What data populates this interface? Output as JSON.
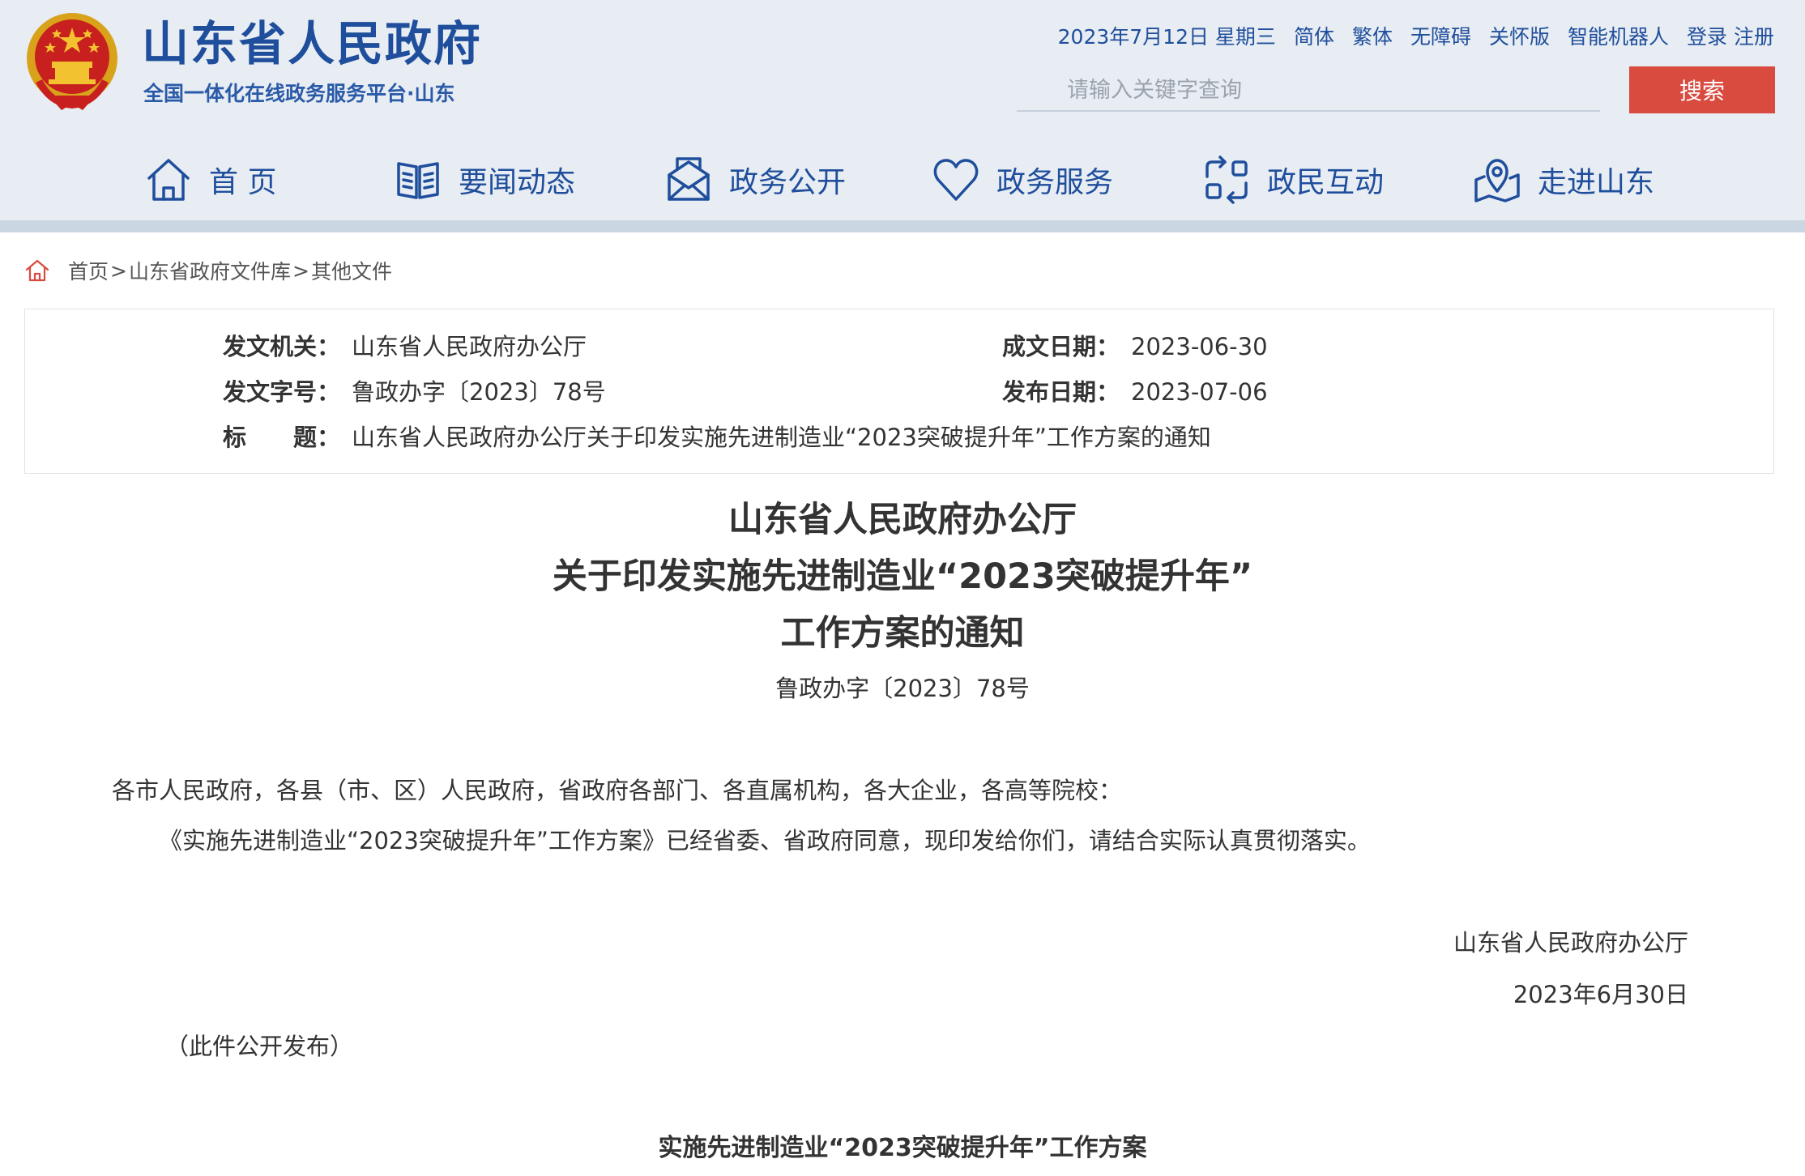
{
  "header": {
    "site_title": "山东省人民政府",
    "site_subtitle": "全国一体化在线政务服务平台·山东",
    "date": "2023年7月12日 星期三",
    "links": [
      "简体",
      "繁体",
      "无障碍",
      "关怀版",
      "智能机器人",
      "登录",
      "注册"
    ],
    "search_placeholder": "请输入关键字查询",
    "search_button": "搜索",
    "colors": {
      "brand": "#1f4e9c",
      "search_button": "#d94a3f",
      "header_bg": "#e8edf3"
    }
  },
  "nav": {
    "items": [
      {
        "label": "首 页",
        "icon": "home-icon"
      },
      {
        "label": "要闻动态",
        "icon": "book-icon"
      },
      {
        "label": "政务公开",
        "icon": "mail-icon"
      },
      {
        "label": "政务服务",
        "icon": "heart-icon"
      },
      {
        "label": "政民互动",
        "icon": "interaction-icon"
      },
      {
        "label": "走进山东",
        "icon": "location-icon"
      }
    ]
  },
  "breadcrumb": {
    "home": "首页",
    "sep": ">",
    "library": "山东省政府文件库",
    "current": "其他文件"
  },
  "info": {
    "issuer_label": "发文机关：",
    "issuer": "山东省人民政府办公厅",
    "doc_no_label": "发文字号：",
    "doc_no": "鲁政办字〔2023〕78号",
    "title_label": "标　　题：",
    "title": "山东省人民政府办公厅关于印发实施先进制造业“2023突破提升年”工作方案的通知",
    "written_date_label": "成文日期：",
    "written_date": "2023-06-30",
    "publish_date_label": "发布日期：",
    "publish_date": "2023-07-06"
  },
  "document": {
    "title_line1": "山东省人民政府办公厅",
    "title_line2": "关于印发实施先进制造业“2023突破提升年”",
    "title_line3": "工作方案的通知",
    "number": "鲁政办字〔2023〕78号",
    "recipients": "各市人民政府，各县（市、区）人民政府，省政府各部门、各直属机构，各大企业，各高等院校：",
    "paragraph1": "《实施先进制造业“2023突破提升年”工作方案》已经省委、省政府同意，现印发给你们，请结合实际认真贯彻落实。",
    "signature": "山东省人民政府办公厅",
    "sign_date": "2023年6月30日",
    "public_note": "（此件公开发布）",
    "section_title": "实施先进制造业“2023突破提升年”工作方案"
  }
}
